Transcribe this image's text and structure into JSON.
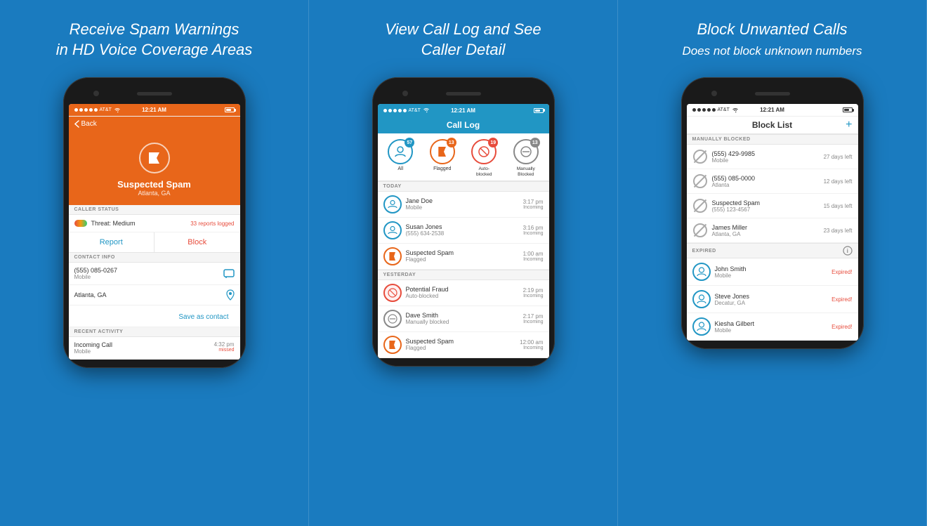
{
  "panels": [
    {
      "id": "panel1",
      "title_line1": "Receive Spam Warnings",
      "title_line2": "in HD Voice Coverage Areas",
      "status_carrier": "AT&T",
      "status_time": "12:21 AM",
      "nav_back": "Back",
      "hero_title": "Suspected Spam",
      "hero_subtitle": "Atlanta, GA",
      "caller_status_header": "CALLER STATUS",
      "threat_label": "Threat: Medium",
      "reports_logged": "33 reports logged",
      "btn_report": "Report",
      "btn_block": "Block",
      "contact_info_header": "CONTACT INFO",
      "phone_number": "(555) 085-0267",
      "phone_type": "Mobile",
      "location": "Atlanta, GA",
      "save_contact": "Save as contact",
      "recent_activity_header": "RECENT ACTIVITY",
      "recent_call_label": "Incoming Call",
      "recent_call_sub": "Mobile",
      "recent_call_time": "4:32 pm",
      "recent_call_status": "missed"
    },
    {
      "id": "panel2",
      "title_line1": "View Call Log and See",
      "title_line2": "Caller Detail",
      "status_carrier": "AT&T",
      "status_time": "12:21 AM",
      "header_title": "Call Log",
      "filter_all_label": "All",
      "filter_all_count": "57",
      "filter_flagged_label": "Flagged",
      "filter_flagged_count": "13",
      "filter_autoblocked_label": "Auto-blocked",
      "filter_autoblocked_count": "19",
      "filter_manually_label": "Manually Blocked",
      "filter_manually_count": "13",
      "today_header": "TODAY",
      "calls_today": [
        {
          "name": "Jane Doe",
          "sub": "Mobile",
          "time": "3:17 pm",
          "direction": "Incoming",
          "type": "user"
        },
        {
          "name": "Susan Jones",
          "sub": "(555) 634-2538",
          "time": "3:16 pm",
          "direction": "Incoming",
          "type": "user"
        },
        {
          "name": "Suspected Spam",
          "sub": "Flagged",
          "time": "1:00 am",
          "direction": "Incoming",
          "type": "flag"
        }
      ],
      "yesterday_header": "YESTERDAY",
      "calls_yesterday": [
        {
          "name": "Potential Fraud",
          "sub": "Auto-blocked",
          "time": "2:19 pm",
          "direction": "Incoming",
          "type": "autoblocked"
        },
        {
          "name": "Dave Smith",
          "sub": "Manually blocked",
          "time": "2:17 pm",
          "direction": "Incoming",
          "type": "manual"
        },
        {
          "name": "Suspected Spam",
          "sub": "Flagged",
          "time": "12:00 am",
          "direction": "Incoming",
          "type": "flag"
        }
      ]
    },
    {
      "id": "panel3",
      "title_line1": "Block Unwanted Calls",
      "title_line2": "Does not block unknown numbers",
      "status_carrier": "AT&T",
      "status_time": "12:21 AM",
      "header_title": "Block List",
      "manually_blocked_header": "MANUALLY BLOCKED",
      "manually_blocked": [
        {
          "name": "(555) 429-9985",
          "sub": "Mobile",
          "status": "27 days left"
        },
        {
          "name": "(555) 085-0000",
          "sub": "Atlanta",
          "status": "12 days left"
        },
        {
          "name": "Suspected Spam",
          "sub": "(555) 123-4567",
          "status": "15 days left"
        },
        {
          "name": "James Miller",
          "sub": "Atlanta, GA",
          "status": "23 days left"
        }
      ],
      "expired_header": "EXPIRED",
      "expired": [
        {
          "name": "John Smith",
          "sub": "Mobile",
          "status": "Expired!"
        },
        {
          "name": "Steve Jones",
          "sub": "Decatur, GA",
          "status": "Expired!"
        },
        {
          "name": "Kiesha Gilbert",
          "sub": "Mobile",
          "status": "Expired!"
        }
      ]
    }
  ]
}
